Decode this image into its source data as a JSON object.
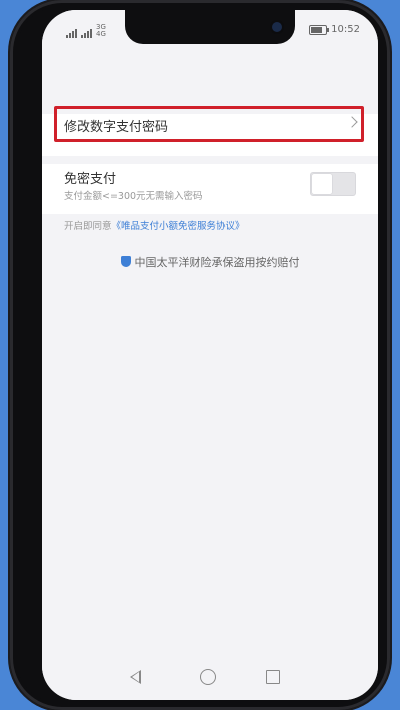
{
  "statusbar": {
    "network_top": "3G",
    "network_bottom": "4G",
    "time": "10:52"
  },
  "settings": {
    "change_pin_label": "修改数字支付密码",
    "free_pay": {
      "title": "免密支付",
      "subtitle": "支付金额<=300元无需输入密码",
      "toggle_state": "off"
    },
    "agreement_prefix": "开启即同意",
    "agreement_link": "《唯品支付小额免密服务协议》",
    "insurer_text": "中国太平洋财险承保盗用按约赔付"
  },
  "colors": {
    "highlight": "#d0202a",
    "link": "#3d7fd6",
    "background": "#4a86d6"
  },
  "icons": {
    "chevron": "chevron-right-icon",
    "insurer": "shield-icon",
    "nav": [
      "back-icon",
      "home-icon",
      "recents-icon"
    ]
  }
}
